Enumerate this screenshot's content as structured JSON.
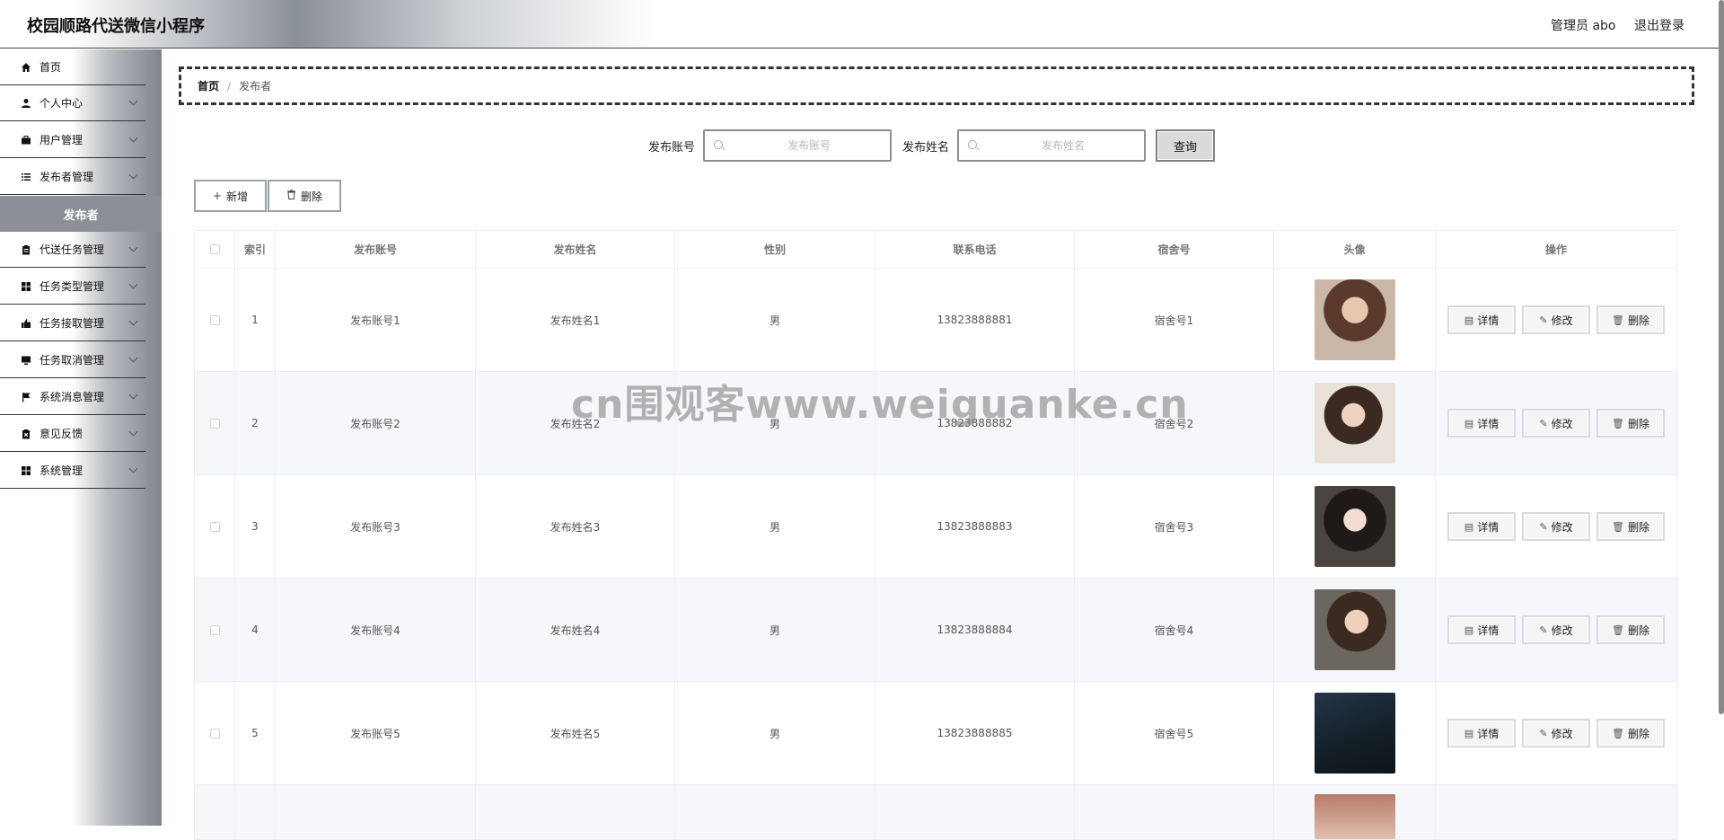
{
  "header": {
    "title": "校园顺路代送微信小程序",
    "admin": "管理员 abo",
    "logout": "退出登录"
  },
  "sidebar": {
    "items": [
      {
        "label": "首页",
        "icon": "home-icon"
      },
      {
        "label": "个人中心",
        "icon": "user-icon"
      },
      {
        "label": "用户管理",
        "icon": "briefcase-icon"
      },
      {
        "label": "发布者管理",
        "icon": "list-icon"
      },
      {
        "label": "代送任务管理",
        "icon": "clipboard-icon"
      },
      {
        "label": "任务类型管理",
        "icon": "grid-icon"
      },
      {
        "label": "任务接取管理",
        "icon": "thumb-icon"
      },
      {
        "label": "任务取消管理",
        "icon": "monitor-icon"
      },
      {
        "label": "系统消息管理",
        "icon": "flag-icon"
      },
      {
        "label": "意见反馈",
        "icon": "clipboard-x-icon"
      },
      {
        "label": "系统管理",
        "icon": "grid-icon"
      }
    ],
    "active_sub": "发布者"
  },
  "breadcrumb": {
    "home": "首页",
    "sep": "/",
    "current": "发布者"
  },
  "search": {
    "account_label": "发布账号",
    "account_placeholder": "发布账号",
    "name_label": "发布姓名",
    "name_placeholder": "发布姓名",
    "query_button": "查询"
  },
  "actions": {
    "add": "新增",
    "delete": "删除"
  },
  "table": {
    "headers": [
      "索引",
      "发布账号",
      "发布姓名",
      "性别",
      "联系电话",
      "宿舍号",
      "头像",
      "操作"
    ],
    "rows": [
      {
        "index": "1",
        "account": "发布账号1",
        "name": "发布姓名1",
        "gender": "男",
        "phone": "13823888881",
        "dorm": "宿舍号1"
      },
      {
        "index": "2",
        "account": "发布账号2",
        "name": "发布姓名2",
        "gender": "男",
        "phone": "13823888882",
        "dorm": "宿舍号2"
      },
      {
        "index": "3",
        "account": "发布账号3",
        "name": "发布姓名3",
        "gender": "男",
        "phone": "13823888883",
        "dorm": "宿舍号3"
      },
      {
        "index": "4",
        "account": "发布账号4",
        "name": "发布姓名4",
        "gender": "男",
        "phone": "13823888884",
        "dorm": "宿舍号4"
      },
      {
        "index": "5",
        "account": "发布账号5",
        "name": "发布姓名5",
        "gender": "男",
        "phone": "13823888885",
        "dorm": "宿舍号5"
      }
    ],
    "op_labels": {
      "detail": "详情",
      "edit": "修改",
      "delete": "删除"
    }
  },
  "watermark": "cn围观客www.weiguanke.cn"
}
